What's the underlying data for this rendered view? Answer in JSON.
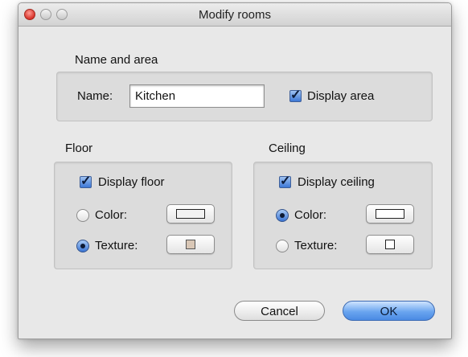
{
  "window": {
    "title": "Modify rooms"
  },
  "name_area": {
    "group_label": "Name and area",
    "name_label": "Name:",
    "name_value": "Kitchen",
    "display_area_label": "Display area",
    "display_area_checked": true
  },
  "floor": {
    "group_label": "Floor",
    "display_label": "Display floor",
    "display_checked": true,
    "color_label": "Color:",
    "texture_label": "Texture:",
    "selected": "texture",
    "color_swatch": "#f2f2f2",
    "texture_swatch": "#d9c7b6"
  },
  "ceiling": {
    "group_label": "Ceiling",
    "display_label": "Display ceiling",
    "display_checked": true,
    "color_label": "Color:",
    "texture_label": "Texture:",
    "selected": "color",
    "color_swatch": "#ffffff",
    "texture_swatch": "#ffffff"
  },
  "buttons": {
    "cancel": "Cancel",
    "ok": "OK"
  }
}
